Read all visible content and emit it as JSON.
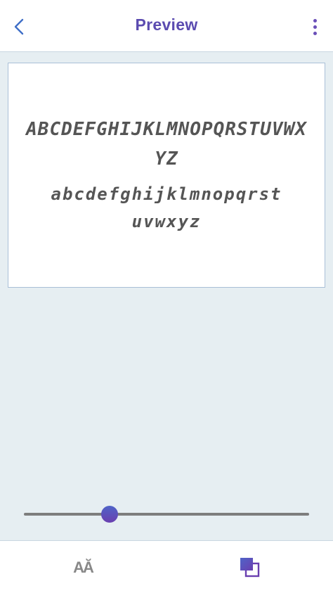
{
  "header": {
    "title": "Preview",
    "back_icon": "chevron-left-icon",
    "menu_icon": "more-vertical-icon"
  },
  "preview": {
    "uppercase_sample": "ABCDEFGHIJKLMNOPQRSTUVWXYZ",
    "lowercase_sample": "abcdefghijklmnopqrstuvwxyz"
  },
  "slider": {
    "value": 0.3
  },
  "bottom_bar": {
    "font_size_label": "AĂ",
    "layers_icon": "layers-icon"
  },
  "colors": {
    "accent": "#5b4bb0",
    "background": "#e6eef2",
    "card": "#ffffff"
  }
}
